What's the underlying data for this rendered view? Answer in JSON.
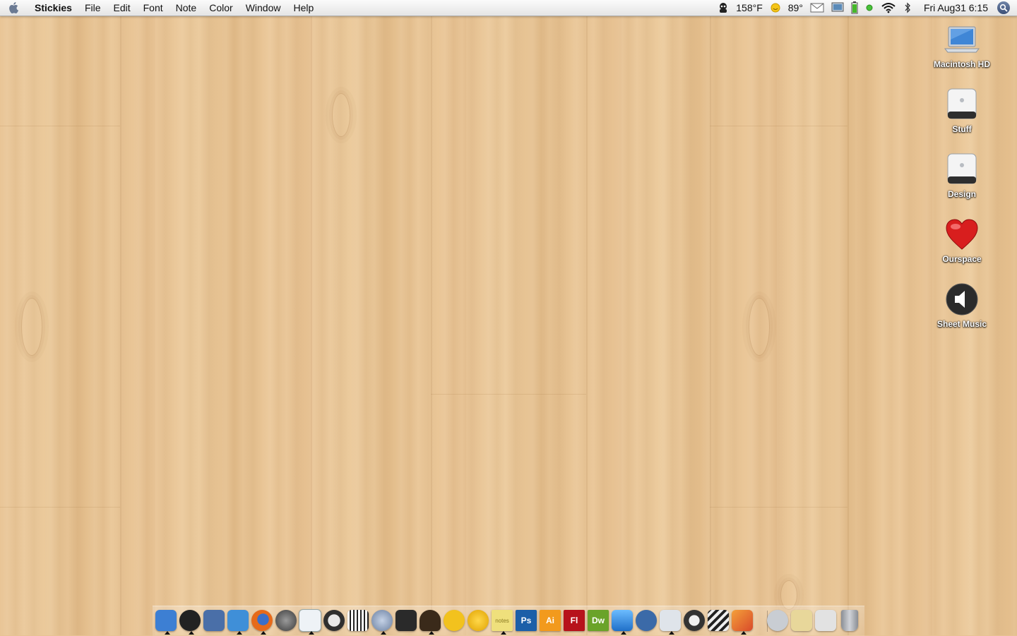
{
  "menubar": {
    "app_name": "Stickies",
    "menus": [
      "File",
      "Edit",
      "Font",
      "Note",
      "Color",
      "Window",
      "Help"
    ],
    "cpu_temp": "158°F",
    "weather_temp": "89°",
    "clock": "Fri Aug31  6:15"
  },
  "desktop_icons": [
    {
      "label": "Macintosh HD",
      "icon": "laptop-icon"
    },
    {
      "label": "Stuff",
      "icon": "external-drive-icon"
    },
    {
      "label": "Design",
      "icon": "external-drive-icon"
    },
    {
      "label": "Ourspace",
      "icon": "heart-icon"
    },
    {
      "label": "Sheet Music",
      "icon": "speaker-icon"
    }
  ],
  "dock": {
    "items": [
      {
        "name": "finder",
        "label": "",
        "color": "#3d7fd3"
      },
      {
        "name": "dashboard",
        "label": "",
        "color": "#222222"
      },
      {
        "name": "photo-app",
        "label": "",
        "color": "#4a6fa8"
      },
      {
        "name": "mail",
        "label": "",
        "color": "#3f8fd8"
      },
      {
        "name": "firefox",
        "label": "",
        "color": "#e66a1a"
      },
      {
        "name": "system-preferences",
        "label": "",
        "color": "#5a5a5a"
      },
      {
        "name": "textedit",
        "label": "",
        "color": "#dfe6ef"
      },
      {
        "name": "quicktime",
        "label": "",
        "color": "#2f2f2f"
      },
      {
        "name": "keyboard-app",
        "label": "",
        "color": "#3a3a3a"
      },
      {
        "name": "itunes",
        "label": "",
        "color": "#6a7fa0"
      },
      {
        "name": "camera-app",
        "label": "",
        "color": "#2a2a2a"
      },
      {
        "name": "adium-like",
        "label": "",
        "color": "#7a4f2a"
      },
      {
        "name": "duck-app",
        "label": "",
        "color": "#f2c21e"
      },
      {
        "name": "yahoo-messenger",
        "label": "",
        "color": "#f0b800"
      },
      {
        "name": "stickies",
        "label": "notes",
        "color": "#efe07c"
      },
      {
        "name": "photoshop",
        "label": "Ps",
        "color": "#1c5fa8"
      },
      {
        "name": "illustrator",
        "label": "Ai",
        "color": "#f29a1d"
      },
      {
        "name": "flash",
        "label": "Fl",
        "color": "#b7121b"
      },
      {
        "name": "dreamweaver",
        "label": "Dw",
        "color": "#6aa32a"
      },
      {
        "name": "wacom-app",
        "label": "",
        "color": "#2c8de0"
      },
      {
        "name": "app-store-like",
        "label": "",
        "color": "#3b6aa8"
      },
      {
        "name": "writing-app",
        "label": "",
        "color": "#cfd6e0"
      },
      {
        "name": "sync-app",
        "label": "",
        "color": "#333333"
      },
      {
        "name": "clapper-app",
        "label": "",
        "color": "#444444"
      },
      {
        "name": "toolkit-app",
        "label": "",
        "color": "#d94a2a"
      }
    ],
    "right_items": [
      {
        "name": "downloads-stack",
        "color": "#c9cdd3"
      },
      {
        "name": "documents-stack",
        "color": "#e8d79a"
      },
      {
        "name": "applications-stack",
        "color": "#e2e2e2"
      },
      {
        "name": "trash",
        "color": "#a7abb2"
      }
    ]
  }
}
